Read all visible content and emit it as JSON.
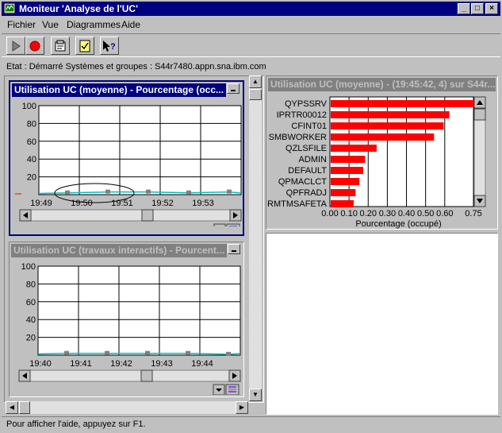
{
  "window": {
    "title": "Moniteur 'Analyse de l'UC'",
    "app_icon": "monitor-icon"
  },
  "menu": [
    "Fichier",
    "Vue",
    "Diagrammes",
    "Aide"
  ],
  "toolbar": {
    "buttons": [
      "start-icon",
      "stop-icon",
      "properties-icon",
      "checklist-icon",
      "help-pointer-icon"
    ]
  },
  "status_top": "Etat : Démarré Systèmes et groupes : S44r7480.appn.sna.ibm.com",
  "graph1": {
    "title": "Utilisation UC (moyenne) - Pourcentage (occ...",
    "y_ticks": [
      "100",
      "80",
      "60",
      "40",
      "20"
    ],
    "x_ticks": [
      "19:49",
      "19:50",
      "19:51",
      "19:52",
      "19:53"
    ]
  },
  "graph2": {
    "title": "Utilisation UC (travaux interactifs) - Pourcent...",
    "y_ticks": [
      "100",
      "80",
      "60",
      "40",
      "20"
    ],
    "x_ticks": [
      "19:40",
      "19:41",
      "19:42",
      "19:43",
      "19:44"
    ]
  },
  "barpanel": {
    "title": "Utilisation UC (moyenne) - (19:45:42, 4) sur S44r...",
    "xlabel": "Pourcentage (occupé)",
    "x_ticks": [
      "0.00",
      "0.10",
      "0.20",
      "0.30",
      "0.40",
      "0.50",
      "0.60",
      "0.75"
    ]
  },
  "chart_data": [
    {
      "type": "line",
      "title": "Utilisation UC (moyenne) - Pourcentage (occ...",
      "x": [
        "19:49",
        "19:50",
        "19:51",
        "19:52",
        "19:53"
      ],
      "ylim": [
        0,
        100
      ],
      "series": [
        {
          "values": [
            2,
            3,
            3,
            2,
            3
          ]
        }
      ],
      "grid": true
    },
    {
      "type": "line",
      "title": "Utilisation UC (travaux interactifs) - Pourcent...",
      "x": [
        "19:40",
        "19:41",
        "19:42",
        "19:43",
        "19:44"
      ],
      "ylim": [
        0,
        100
      ],
      "series": [
        {
          "values": [
            2,
            2,
            2,
            2,
            1
          ]
        }
      ],
      "grid": true
    },
    {
      "type": "bar",
      "orientation": "horizontal",
      "title": "Utilisation UC (moyenne) - (19:45:42, 4) sur S44r...",
      "xlabel": "Pourcentage (occupé)",
      "categories": [
        "QYPSSRV",
        "IPRTR00012",
        "CFINT01",
        "SMBWORKER",
        "QZLSFILE",
        "ADMIN",
        "DEFAULT",
        "QPMACLCT",
        "QPFRADJ",
        "RMTMSAFETA"
      ],
      "values": [
        0.75,
        0.62,
        0.59,
        0.54,
        0.24,
        0.18,
        0.17,
        0.15,
        0.13,
        0.12
      ],
      "xlim": [
        0,
        0.75
      ],
      "color": "#ff0000"
    }
  ],
  "status_bottom": "Pour afficher l'aide, appuyez sur F1."
}
